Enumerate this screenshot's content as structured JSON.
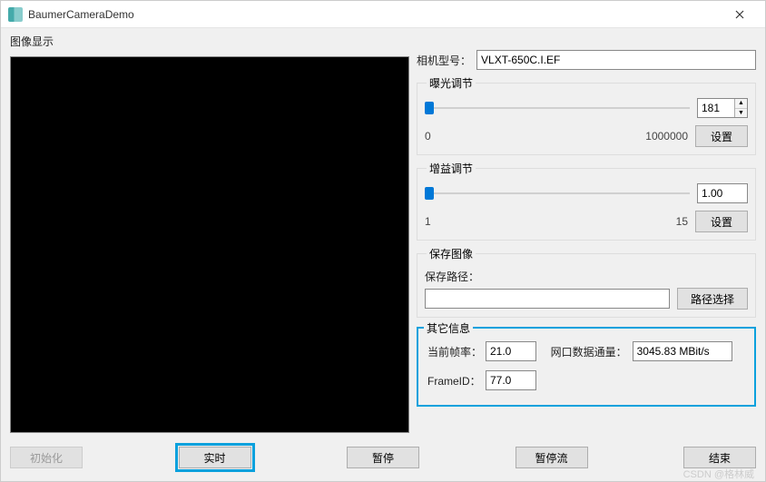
{
  "window": {
    "title": "BaumerCameraDemo"
  },
  "imageDisplay": {
    "legend": "图像显示"
  },
  "cameraModel": {
    "label": "相机型号：",
    "value": "VLXT-650C.I.EF"
  },
  "exposure": {
    "legend": "曝光调节",
    "value": "181",
    "min": "0",
    "max": "1000000",
    "setButton": "设置",
    "sliderPercent": 0
  },
  "gain": {
    "legend": "增益调节",
    "value": "1.00",
    "min": "1",
    "max": "15",
    "setButton": "设置",
    "sliderPercent": 0
  },
  "saveImage": {
    "legend": "保存图像",
    "pathLabel": "保存路径：",
    "pathValue": "",
    "browseButton": "路径选择"
  },
  "otherInfo": {
    "legend": "其它信息",
    "fpsLabel": "当前帧率：",
    "fpsValue": "21.0",
    "throughputLabel": "网口数据通量：",
    "throughputValue": "3045.83 MBit/s",
    "frameIdLabel": "FrameID：",
    "frameIdValue": "77.0"
  },
  "footer": {
    "init": "初始化",
    "live": "实时",
    "pause": "暂停",
    "pauseStream": "暂停流",
    "end": "结束"
  },
  "watermark": "CSDN @格林威"
}
